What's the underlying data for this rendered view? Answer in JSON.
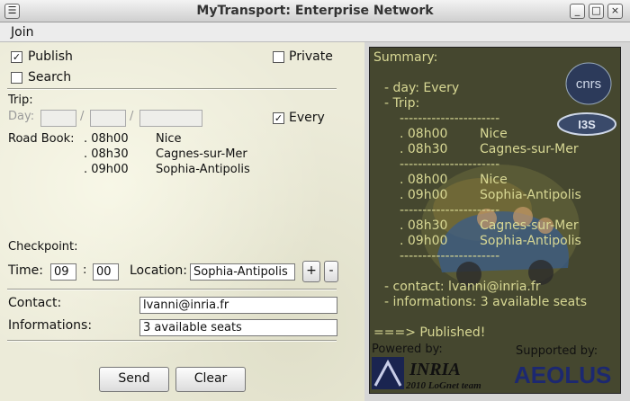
{
  "window": {
    "title": "MyTransport: Enterprise Network",
    "minimize": "_",
    "maximize": "□",
    "close": "×"
  },
  "menu": {
    "join": "Join"
  },
  "form": {
    "publish": {
      "label": "Publish",
      "checked": true
    },
    "search": {
      "label": "Search",
      "checked": false
    },
    "private": {
      "label": "Private",
      "checked": false
    },
    "trip_label": "Trip:",
    "day_label": "Day:",
    "date_sep": "/",
    "every": {
      "label": "Every",
      "checked": true
    },
    "roadbook_label": "Road Book:",
    "roadbook": [
      {
        "time": ". 08h00",
        "place": "Nice"
      },
      {
        "time": ". 08h30",
        "place": "Cagnes-sur-Mer"
      },
      {
        "time": ". 09h00",
        "place": "Sophia-Antipolis"
      }
    ],
    "checkpoint_label": "Checkpoint:",
    "time_label": "Time:",
    "time_hour": "09",
    "time_colon": ":",
    "time_min": "00",
    "location_label": "Location:",
    "location_value": "Sophia-Antipolis",
    "add": "+",
    "remove": "-",
    "contact_label": "Contact:",
    "contact_value": "lvanni@inria.fr",
    "informations_label": "Informations:",
    "informations_value": "3 available seats",
    "send": "Send",
    "clear": "Clear"
  },
  "summary": {
    "lines": [
      "Summary:",
      "- day: Every",
      "- Trip:",
      "----------------------",
      ". 08h00        Nice",
      ". 08h30        Cagnes-sur-Mer",
      "----------------------",
      ". 08h00        Nice",
      ". 09h00        Sophia-Antipolis",
      "----------------------",
      ". 08h30        Cagnes-sur-Mer",
      ". 09h00        Sophia-Antipolis",
      "----------------------",
      "- contact: lvanni@inria.fr",
      "- informations: 3 available seats",
      "===> Published!"
    ],
    "powered_by": "Powered by:",
    "supported_by": "Supported by:",
    "inria": "INRIA",
    "inria_sub": "2010 LoGnet team",
    "aeolus": "AEOLUS",
    "cnrs": "cnrs",
    "i3s": "I3S"
  },
  "colors": {
    "summary_bg": "#45472f",
    "summary_text": "#d8d894",
    "panel_bg": "#ecebd9"
  }
}
